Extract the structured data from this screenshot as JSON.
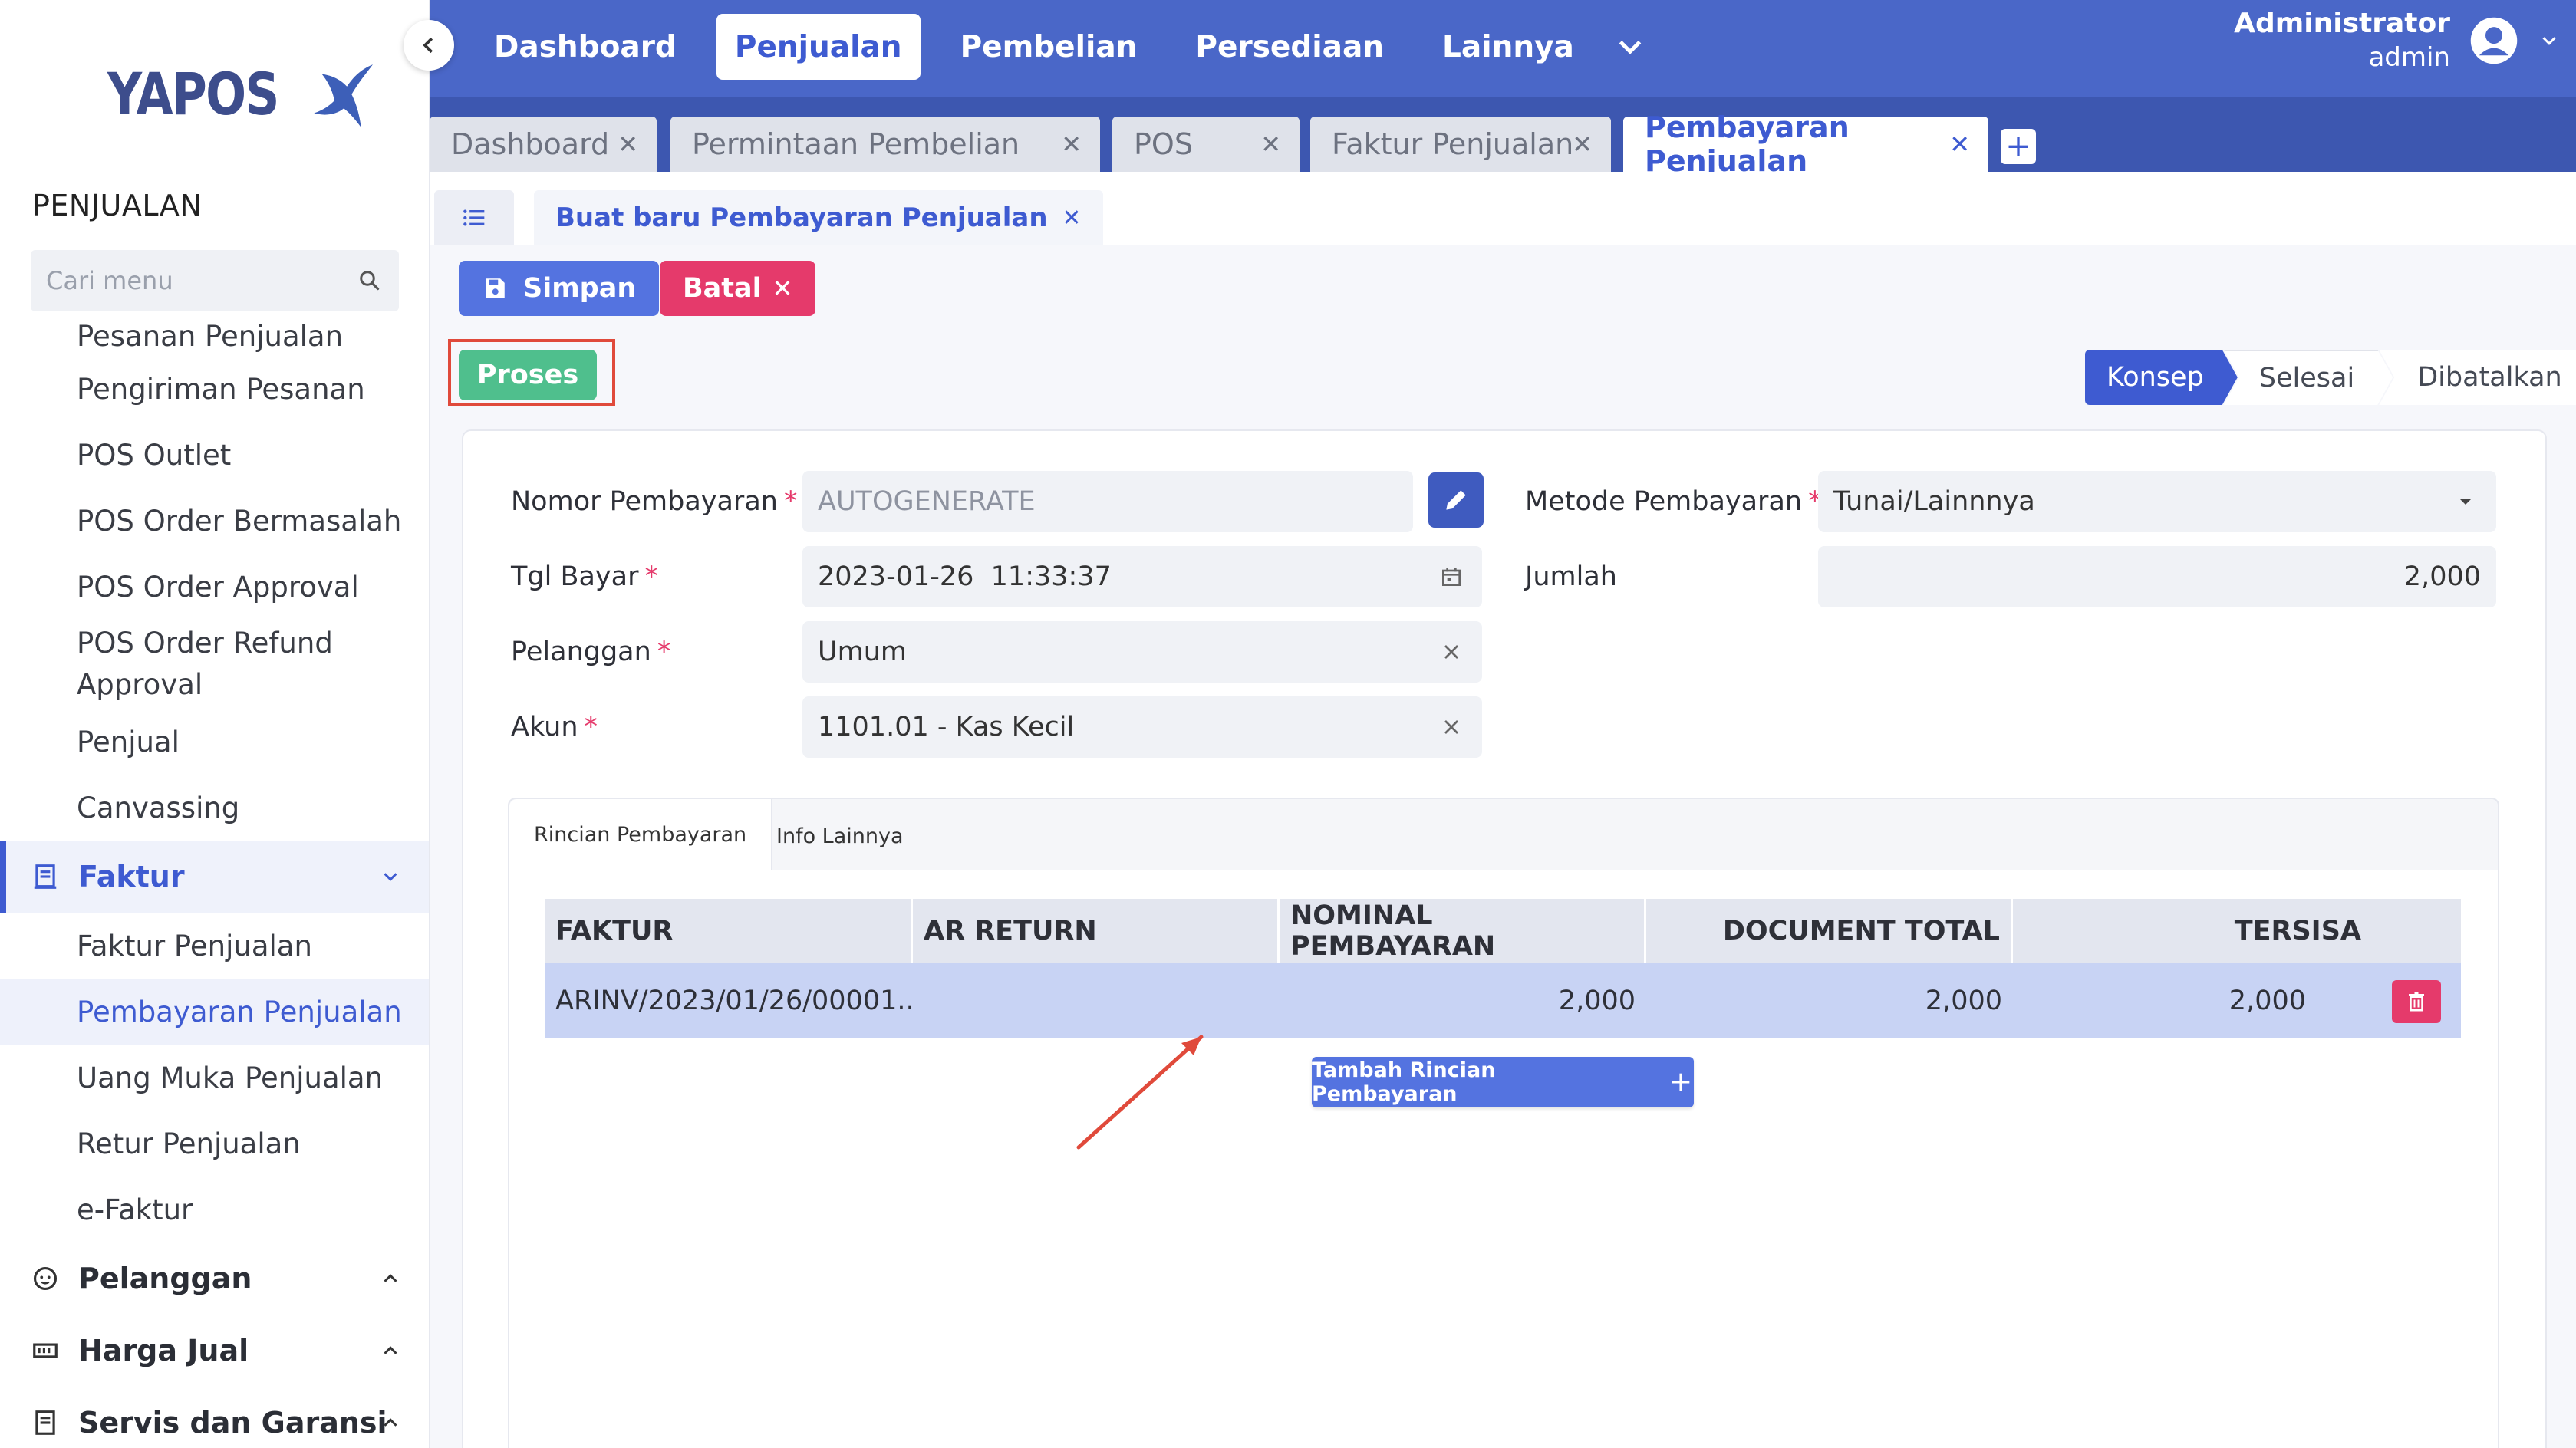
{
  "app": {
    "logo_text": "YAPOS",
    "section_title": "PENJUALAN"
  },
  "sidebar": {
    "search_placeholder": "Cari menu",
    "items_top": [
      "Pesanan Penjualan",
      "Pengiriman Pesanan",
      "POS Outlet",
      "POS Order Bermasalah",
      "POS Order Approval",
      "POS Order Refund Approval",
      "Penjual",
      "Canvassing"
    ],
    "group_faktur": "Faktur",
    "faktur_items": [
      "Faktur Penjualan",
      "Pembayaran Penjualan",
      "Uang Muka Penjualan",
      "Retur Penjualan",
      "e-Faktur"
    ],
    "group_pelanggan": "Pelanggan",
    "group_harga": "Harga Jual",
    "group_servis": "Servis dan Garansi"
  },
  "topnav": {
    "items": [
      "Dashboard",
      "Penjualan",
      "Pembelian",
      "Persediaan",
      "Lainnya"
    ],
    "user_name": "Administrator",
    "user_role": "admin"
  },
  "tabs": [
    "Dashboard",
    "Permintaan Pembelian",
    "POS",
    "Faktur Penjualan",
    "Pembayaran Penjualan"
  ],
  "subtab": "Buat baru Pembayaran Penjualan",
  "actions": {
    "save": "Simpan",
    "cancel": "Batal",
    "process": "Proses"
  },
  "status_steps": [
    "Konsep",
    "Selesai",
    "Dibatalkan"
  ],
  "form": {
    "nomor_label": "Nomor Pembayaran",
    "nomor_value": "AUTOGENERATE",
    "tgl_label": "Tgl Bayar",
    "tgl_value": "2023-01-26  11:33:37",
    "pelanggan_label": "Pelanggan",
    "pelanggan_value": "Umum",
    "akun_label": "Akun",
    "akun_value": "1101.01 - Kas Kecil",
    "metode_label": "Metode Pembayaran",
    "metode_value": "Tunai/Lainnnya",
    "jumlah_label": "Jumlah",
    "jumlah_value": "2,000"
  },
  "detail_tabs": [
    "Rincian Pembayaran",
    "Info Lainnya"
  ],
  "table": {
    "headers": [
      "FAKTUR",
      "AR RETURN",
      "NOMINAL PEMBAYARAN",
      "DOCUMENT TOTAL",
      "TERSISA"
    ],
    "rows": [
      {
        "faktur": "ARINV/2023/01/26/00001...",
        "ar_return": "",
        "nominal": "2,000",
        "total": "2,000",
        "tersisa": "2,000"
      }
    ]
  },
  "add_detail_label": "Tambah Rincian Pembayaran",
  "colors": {
    "primary": "#3e5bd1",
    "nav": "#4a67c8",
    "success": "#4fbf8d",
    "danger": "#e53a6b",
    "annotation": "#e04a3b"
  }
}
